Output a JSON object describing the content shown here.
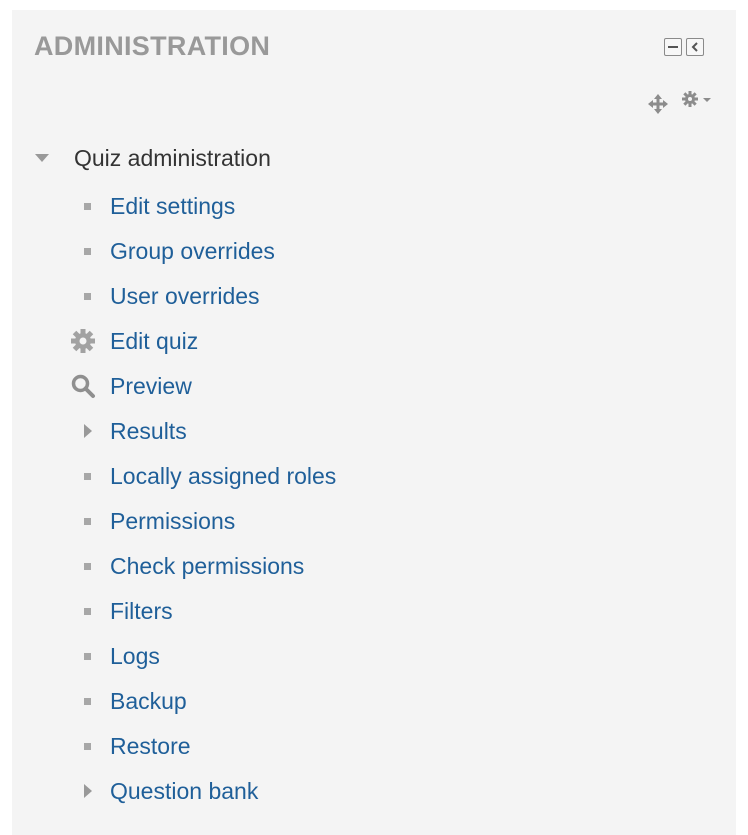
{
  "block": {
    "title": "ADMINISTRATION",
    "controls": {
      "hide_icon": "minus-box-icon",
      "dock_icon": "dock-left-icon",
      "move_icon": "move-cross-icon",
      "actions_icon": "gear-dropdown-icon"
    }
  },
  "tree": {
    "root": {
      "label": "Quiz administration",
      "icon": "triangle-down-icon",
      "expanded": true
    },
    "items": [
      {
        "label": "Edit settings",
        "icon": "bullet-icon"
      },
      {
        "label": "Group overrides",
        "icon": "bullet-icon"
      },
      {
        "label": "User overrides",
        "icon": "bullet-icon"
      },
      {
        "label": "Edit quiz",
        "icon": "gear-icon"
      },
      {
        "label": "Preview",
        "icon": "magnifier-icon"
      },
      {
        "label": "Results",
        "icon": "triangle-right-icon",
        "expanded": false
      },
      {
        "label": "Locally assigned roles",
        "icon": "bullet-icon"
      },
      {
        "label": "Permissions",
        "icon": "bullet-icon"
      },
      {
        "label": "Check permissions",
        "icon": "bullet-icon"
      },
      {
        "label": "Filters",
        "icon": "bullet-icon"
      },
      {
        "label": "Logs",
        "icon": "bullet-icon"
      },
      {
        "label": "Backup",
        "icon": "bullet-icon"
      },
      {
        "label": "Restore",
        "icon": "bullet-icon"
      },
      {
        "label": "Question bank",
        "icon": "triangle-right-icon",
        "expanded": false
      }
    ]
  },
  "colors": {
    "panel_bg": "#f4f4f4",
    "title": "#999999",
    "link": "#1f5f99",
    "root_text": "#333333",
    "icon_gray": "#a7a7a7"
  }
}
